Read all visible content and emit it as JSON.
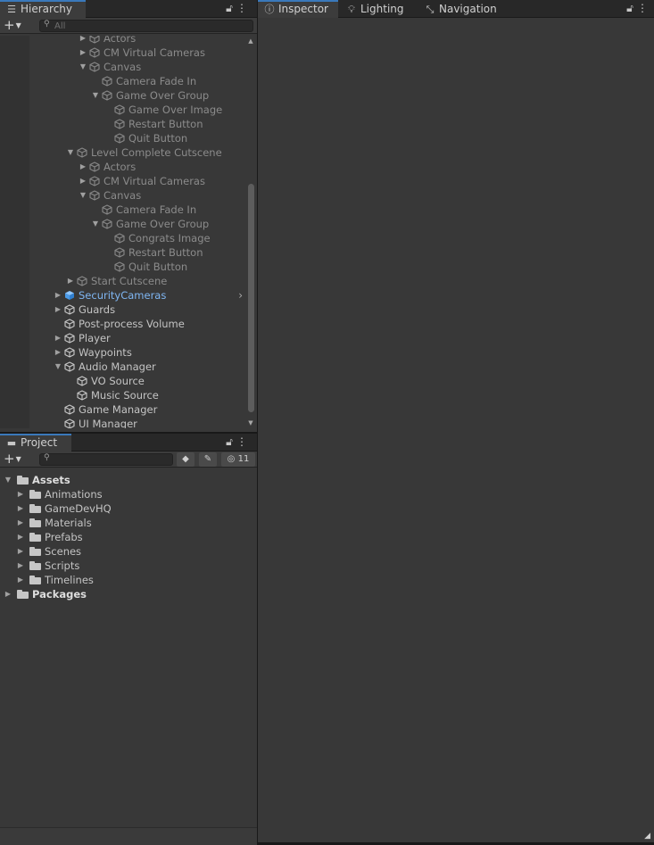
{
  "hierarchy": {
    "tab_label": "Hierarchy",
    "icon": "list-icon",
    "search_placeholder": "All",
    "rows": [
      {
        "label": "Actors",
        "indent": 5,
        "expand": "closed",
        "dim": true
      },
      {
        "label": "CM Virtual Cameras",
        "indent": 5,
        "expand": "closed",
        "dim": true
      },
      {
        "label": "Canvas",
        "indent": 5,
        "expand": "open",
        "dim": true
      },
      {
        "label": "Camera Fade In",
        "indent": 6,
        "expand": "none",
        "dim": true
      },
      {
        "label": "Game Over Group",
        "indent": 6,
        "expand": "open",
        "dim": true
      },
      {
        "label": "Game Over Image",
        "indent": 7,
        "expand": "none",
        "dim": true
      },
      {
        "label": "Restart Button",
        "indent": 7,
        "expand": "none",
        "dim": true
      },
      {
        "label": "Quit Button",
        "indent": 7,
        "expand": "none",
        "dim": true
      },
      {
        "label": "Level Complete Cutscene",
        "indent": 4,
        "expand": "open",
        "dim": true
      },
      {
        "label": "Actors",
        "indent": 5,
        "expand": "closed",
        "dim": true
      },
      {
        "label": "CM Virtual Cameras",
        "indent": 5,
        "expand": "closed",
        "dim": true
      },
      {
        "label": "Canvas",
        "indent": 5,
        "expand": "open",
        "dim": true
      },
      {
        "label": "Camera Fade In",
        "indent": 6,
        "expand": "none",
        "dim": true
      },
      {
        "label": "Game Over Group",
        "indent": 6,
        "expand": "open",
        "dim": true
      },
      {
        "label": "Congrats Image",
        "indent": 7,
        "expand": "none",
        "dim": true
      },
      {
        "label": "Restart Button",
        "indent": 7,
        "expand": "none",
        "dim": true
      },
      {
        "label": "Quit Button",
        "indent": 7,
        "expand": "none",
        "dim": true
      },
      {
        "label": "Start Cutscene",
        "indent": 4,
        "expand": "closed",
        "dim": true
      },
      {
        "label": "SecurityCameras",
        "indent": 3,
        "expand": "closed",
        "prefab": true
      },
      {
        "label": "Guards",
        "indent": 3,
        "expand": "closed"
      },
      {
        "label": "Post-process Volume",
        "indent": 3,
        "expand": "none"
      },
      {
        "label": "Player",
        "indent": 3,
        "expand": "closed"
      },
      {
        "label": "Waypoints",
        "indent": 3,
        "expand": "closed"
      },
      {
        "label": "Audio Manager",
        "indent": 3,
        "expand": "open"
      },
      {
        "label": "VO Source",
        "indent": 4,
        "expand": "none"
      },
      {
        "label": "Music Source",
        "indent": 4,
        "expand": "none"
      },
      {
        "label": "Game Manager",
        "indent": 3,
        "expand": "none"
      },
      {
        "label": "UI Manager",
        "indent": 3,
        "expand": "none"
      }
    ]
  },
  "project": {
    "tab_label": "Project",
    "icon": "folder-icon",
    "hidden_count": "11",
    "items": [
      {
        "label": "Assets",
        "level": 0,
        "expand": "open",
        "bold": true
      },
      {
        "label": "Animations",
        "level": 1,
        "expand": "closed"
      },
      {
        "label": "GameDevHQ",
        "level": 1,
        "expand": "closed"
      },
      {
        "label": "Materials",
        "level": 1,
        "expand": "closed"
      },
      {
        "label": "Prefabs",
        "level": 1,
        "expand": "closed"
      },
      {
        "label": "Scenes",
        "level": 1,
        "expand": "closed"
      },
      {
        "label": "Scripts",
        "level": 1,
        "expand": "closed"
      },
      {
        "label": "Timelines",
        "level": 1,
        "expand": "closed"
      },
      {
        "label": "Packages",
        "level": 0,
        "expand": "closed",
        "bold": true
      }
    ]
  },
  "right_tabs": [
    {
      "label": "Inspector",
      "icon": "info-icon",
      "active": true
    },
    {
      "label": "Lighting",
      "icon": "lightbulb-icon",
      "active": false
    },
    {
      "label": "Navigation",
      "icon": "navigation-icon",
      "active": false
    }
  ],
  "colors": {
    "accent": "#3a79bb",
    "prefab_text": "#7fb6f2",
    "panel_bg": "#383838"
  }
}
